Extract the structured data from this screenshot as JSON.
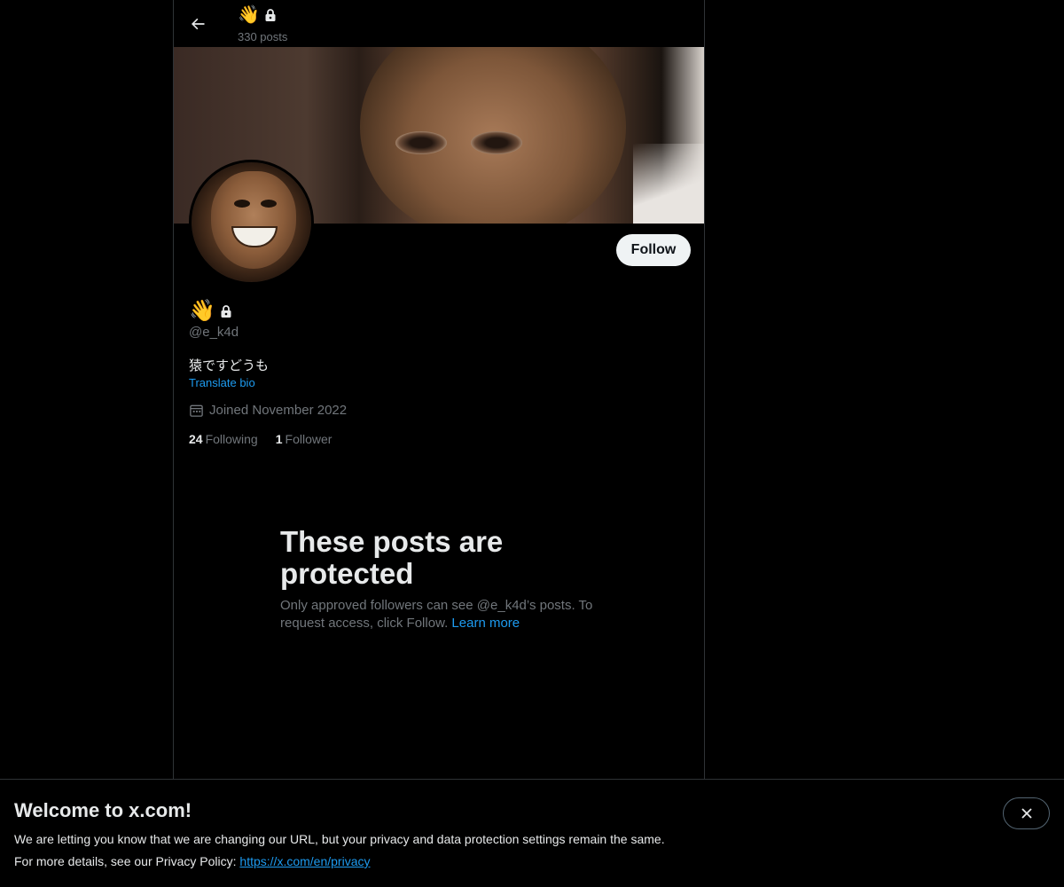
{
  "header": {
    "title_emoji": "👋",
    "post_count": "330 posts"
  },
  "profile": {
    "name_emoji": "👋",
    "handle": "@e_k4d",
    "bio": "猿ですどうも",
    "translate_label": "Translate bio",
    "joined": "Joined November 2022",
    "following_count": "24",
    "following_label": "Following",
    "follower_count": "1",
    "follower_label": "Follower",
    "follow_button": "Follow"
  },
  "protected": {
    "heading": "These posts are protected",
    "body": "Only approved followers can see @e_k4d’s posts. To request access, click Follow.",
    "learn_more": "Learn more"
  },
  "notice": {
    "title": "Welcome to x.com!",
    "line1": "We are letting you know that we are changing our URL, but your privacy and data protection settings remain the same.",
    "line2_prefix": "For more details, see our Privacy Policy:",
    "link": "https://x.com/en/privacy"
  },
  "colors": {
    "background": "#000000",
    "text_primary": "#e7e9ea",
    "text_secondary": "#71767b",
    "accent": "#1d9bf0",
    "follow_button_bg": "#eff3f4"
  },
  "icons": [
    "back-arrow-icon",
    "lock-icon",
    "calendar-icon",
    "close-icon"
  ]
}
